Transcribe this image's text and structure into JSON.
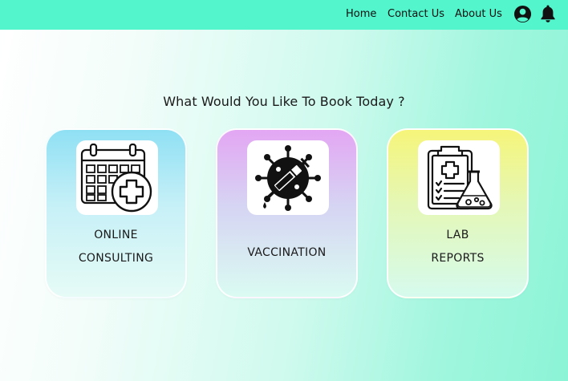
{
  "nav": {
    "home": "Home",
    "contact": "Contact Us",
    "about": "About Us",
    "icons": [
      "account-circle-icon",
      "bell-icon"
    ]
  },
  "main": {
    "title": "What Would You Like To Book Today ?",
    "cards": [
      {
        "line1": "ONLINE",
        "line2": "CONSULTING",
        "icon": "calendar-plus-icon"
      },
      {
        "line1": "VACCINATION",
        "icon": "syringe-virus-icon"
      },
      {
        "line1": "LAB",
        "line2": "REPORTS",
        "icon": "clipboard-flask-icon"
      }
    ]
  },
  "colors": {
    "navbar": "#52f5cc",
    "card_consult_top": "#8fe0f4",
    "card_vacc_top": "#e3a6f3",
    "card_lab_top": "#f6f57a"
  }
}
